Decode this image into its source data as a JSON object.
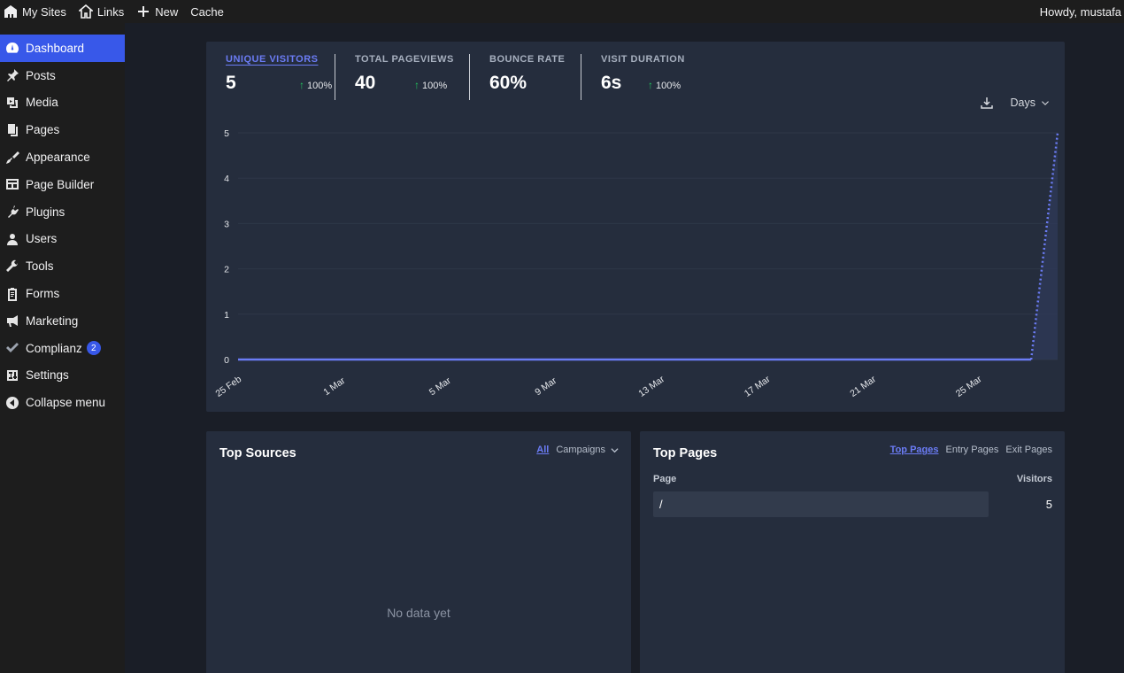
{
  "adminbar": {
    "my_sites": "My Sites",
    "links": "Links",
    "new": "New",
    "cache": "Cache",
    "greeting": "Howdy, mustafa"
  },
  "sidebar": {
    "items": [
      {
        "label": "Dashboard",
        "icon": "dashboard-icon"
      },
      {
        "label": "Posts",
        "icon": "pin-icon"
      },
      {
        "label": "Media",
        "icon": "media-icon"
      },
      {
        "label": "Pages",
        "icon": "pages-icon"
      },
      {
        "label": "Appearance",
        "icon": "brush-icon"
      },
      {
        "label": "Page Builder",
        "icon": "layout-icon"
      },
      {
        "label": "Plugins",
        "icon": "plugin-icon"
      },
      {
        "label": "Users",
        "icon": "user-icon"
      },
      {
        "label": "Tools",
        "icon": "wrench-icon"
      },
      {
        "label": "Forms",
        "icon": "clipboard-icon"
      },
      {
        "label": "Marketing",
        "icon": "megaphone-icon"
      },
      {
        "label": "Complianz",
        "icon": "check-icon",
        "badge": "2"
      },
      {
        "label": "Settings",
        "icon": "settings-icon"
      },
      {
        "label": "Collapse menu",
        "icon": "collapse-icon"
      }
    ]
  },
  "stats": {
    "unique_visitors": {
      "label": "UNIQUE VISITORS",
      "value": "5",
      "change": "100%"
    },
    "total_pageviews": {
      "label": "TOTAL PAGEVIEWS",
      "value": "40",
      "change": "100%"
    },
    "bounce_rate": {
      "label": "BOUNCE RATE",
      "value": "60%"
    },
    "visit_duration": {
      "label": "VISIT DURATION",
      "value": "6s",
      "change": "100%"
    }
  },
  "interval": {
    "label": "Days"
  },
  "chart_data": {
    "type": "line",
    "title": "",
    "xlabel": "",
    "ylabel": "",
    "x_tick_labels": [
      "25 Feb",
      "1 Mar",
      "5 Mar",
      "9 Mar",
      "13 Mar",
      "17 Mar",
      "21 Mar",
      "25 Mar"
    ],
    "y_ticks": [
      0,
      1,
      2,
      3,
      4,
      5
    ],
    "ylim": [
      0,
      5
    ],
    "x": [
      "25 Feb",
      "26 Feb",
      "27 Feb",
      "28 Feb",
      "1 Mar",
      "2 Mar",
      "3 Mar",
      "4 Mar",
      "5 Mar",
      "6 Mar",
      "7 Mar",
      "8 Mar",
      "9 Mar",
      "10 Mar",
      "11 Mar",
      "12 Mar",
      "13 Mar",
      "14 Mar",
      "15 Mar",
      "16 Mar",
      "17 Mar",
      "18 Mar",
      "19 Mar",
      "20 Mar",
      "21 Mar",
      "22 Mar",
      "23 Mar",
      "24 Mar",
      "25 Mar",
      "26 Mar",
      "27 Mar",
      "28 Mar"
    ],
    "series": [
      {
        "values": [
          0,
          0,
          0,
          0,
          0,
          0,
          0,
          0,
          0,
          0,
          0,
          0,
          0,
          0,
          0,
          0,
          0,
          0,
          0,
          0,
          0,
          0,
          0,
          0,
          0,
          0,
          0,
          0,
          0,
          0,
          0,
          5
        ],
        "color": "#6b7cf5"
      }
    ],
    "grid": true
  },
  "top_sources": {
    "title": "Top Sources",
    "tab_all": "All",
    "tab_campaigns": "Campaigns",
    "empty": "No data yet"
  },
  "top_pages": {
    "title": "Top Pages",
    "tab_top": "Top Pages",
    "tab_entry": "Entry Pages",
    "tab_exit": "Exit Pages",
    "col_page": "Page",
    "col_visitors": "Visitors",
    "rows": [
      {
        "page": "/",
        "visitors": "5"
      }
    ]
  }
}
